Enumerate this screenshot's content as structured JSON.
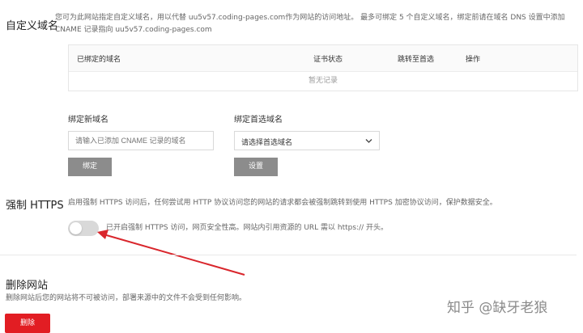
{
  "custom_domain": {
    "title": "自定义域名",
    "desc_line1": "您可为此网站指定自定义域名，用以代替 uu5v57.coding-pages.com作为网站的访问地址。 最多可绑定 5 个自定义域名，绑定前请在域名 DNS 设置中添加",
    "desc_line2": "CNAME 记录指向 uu5v57.coding-pages.com",
    "table": {
      "col_domain": "已绑定的域名",
      "col_cert": "证书状态",
      "col_redirect": "跳转至首选",
      "col_action": "操作",
      "empty_text": "暂无记录"
    },
    "bind_new": {
      "label": "绑定新域名",
      "placeholder": "请输入已添加 CNAME 记录的域名",
      "button": "绑定"
    },
    "bind_preferred": {
      "label": "绑定首选域名",
      "select_value": "请选择首选域名",
      "button": "设置"
    }
  },
  "force_https": {
    "title": "强制 HTTPS",
    "desc": "启用强制 HTTPS 访问后，任何尝试用 HTTP 协议访问您的网站的请求都会被强制跳转到使用 HTTPS 加密协议访问，保护数据安全。",
    "toggle_on": false,
    "toggle_text": "已开启强制 HTTPS 访问，网页安全性高。网站内引用资源的 URL 需以 https:// 开头。"
  },
  "delete_site": {
    "title": "删除网站",
    "desc": "删除网站后您的网站将不可被访问，部署来源中的文件不会受到任何影响。",
    "button": "删除"
  },
  "watermark": "知乎 @缺牙老狼",
  "colors": {
    "delete_red": "#e21d23",
    "button_gray": "#8c8c8c",
    "arrow_red": "#d9262c"
  },
  "icons": {
    "select_arrow": "chevron-down-icon",
    "annotation": "arrow-annotation"
  }
}
